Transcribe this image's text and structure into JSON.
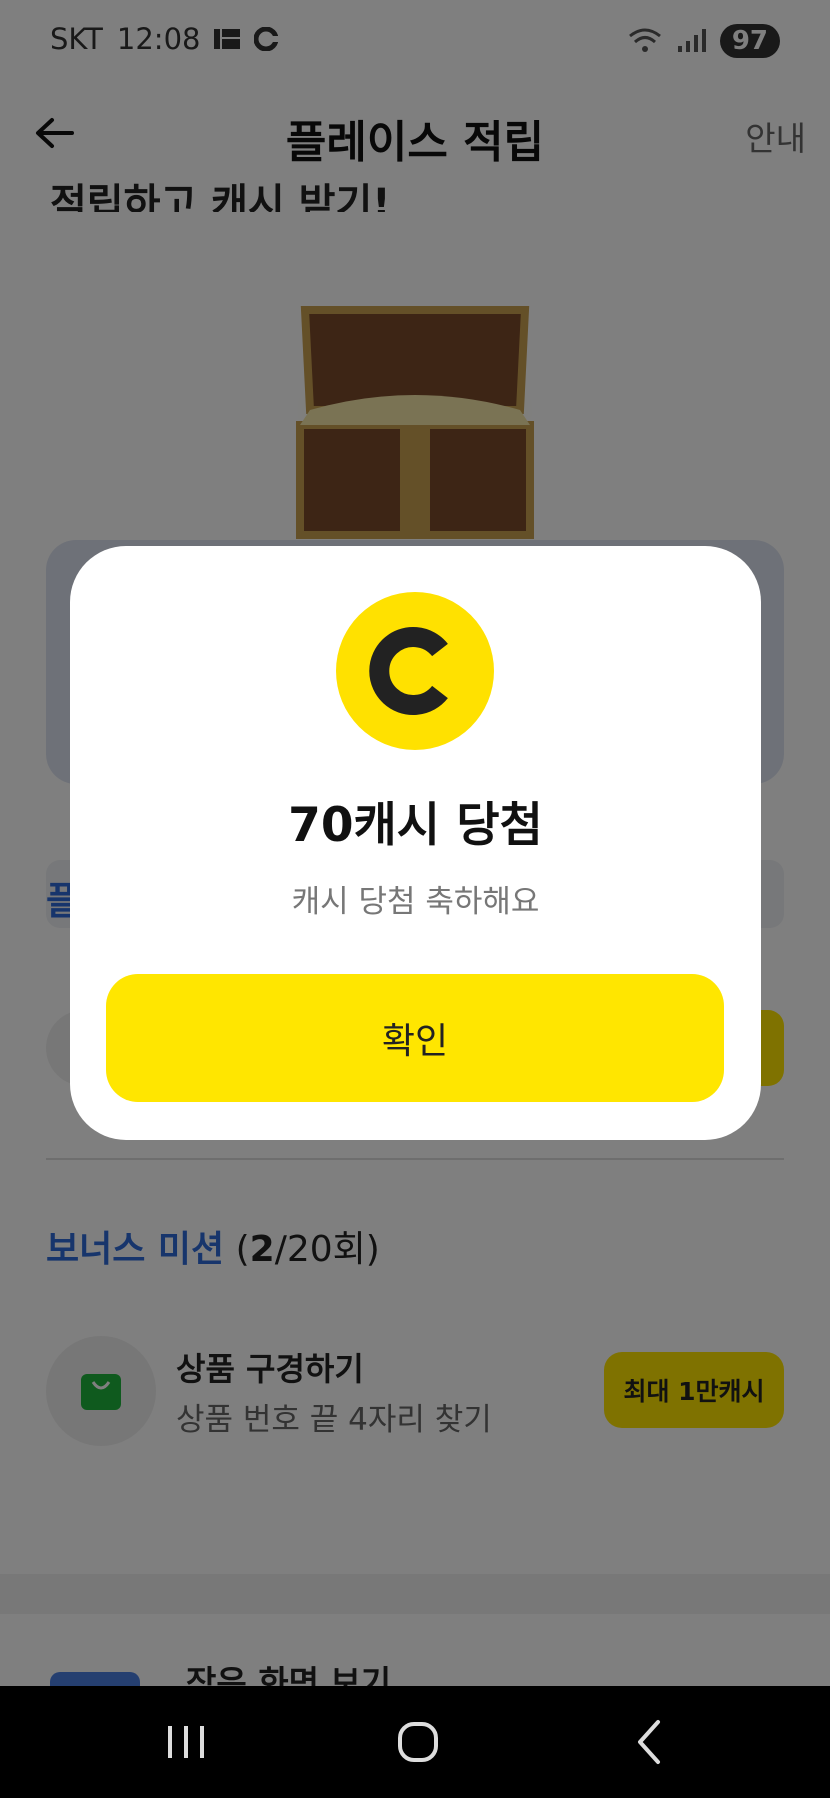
{
  "status_bar": {
    "carrier": "SKT",
    "time": "12:08",
    "battery": "97"
  },
  "header": {
    "title": "플레이스 적립",
    "guide": "안내"
  },
  "background": {
    "partial_heading": "적립하고 캐시 받기!",
    "blue_fragment": "플",
    "bonus_title": "보너스 미션",
    "bonus_count_current": "2",
    "bonus_count_total": "/20회)",
    "bonus_count_open": "(",
    "mission": {
      "title": "상품 구경하기",
      "subtitle": "상품 번호 끝 4자리 찾기",
      "button": "최대 1만캐시"
    },
    "small_screen": "작은 화면 보기"
  },
  "modal": {
    "title": "70캐시 당첨",
    "subtitle": "캐시 당첨 축하해요",
    "confirm": "확인"
  },
  "colors": {
    "accent_yellow": "#ffe600",
    "link_blue": "#2f6bd8",
    "coin_yellow": "#ffe100"
  },
  "icons": {
    "back": "arrow-left-icon",
    "coin": "cash-coin-icon",
    "bag": "shopping-bag-icon",
    "chest": "treasure-chest-icon"
  }
}
